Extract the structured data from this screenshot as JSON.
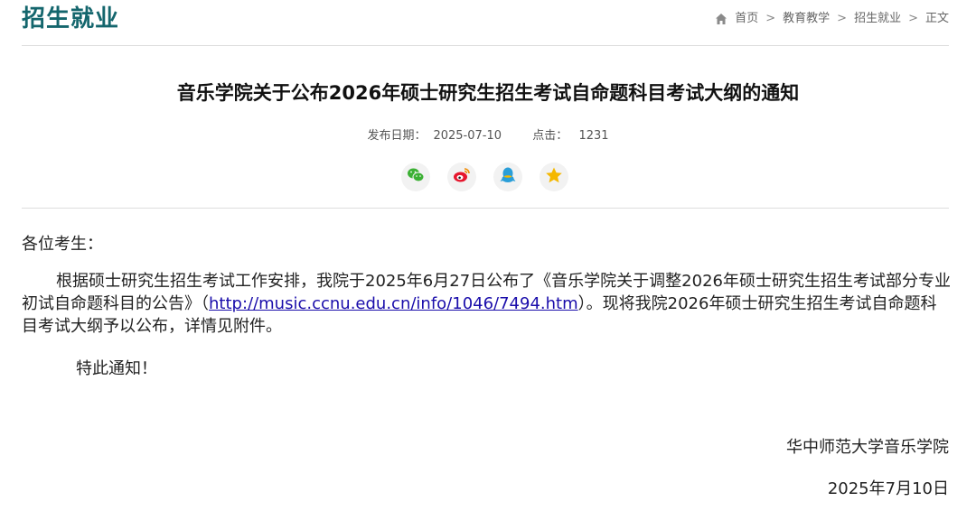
{
  "header": {
    "section_title": "招生就业",
    "breadcrumb": {
      "home": "首页",
      "items": [
        "教育教学",
        "招生就业",
        "正文"
      ],
      "separator": ">"
    }
  },
  "article": {
    "title": "音乐学院关于公布2026年硕士研究生招生考试自命题科目考试大纲的通知",
    "meta": {
      "date_label": "发布日期：",
      "date": "2025-07-10",
      "clicks_label": "点击：",
      "clicks": "1231"
    },
    "share": {
      "icons": [
        "wechat-icon",
        "weibo-icon",
        "qq-icon",
        "favorite-star-icon"
      ]
    },
    "body": {
      "greeting": "各位考生：",
      "para_before_link": "根据硕士研究生招生考试工作安排，我院于2025年6月27日公布了《音乐学院关于调整2026年硕士研究生招生考试部分专业初试自命题科目的公告》（",
      "link_text": "http://music.ccnu.edu.cn/info/1046/7494.htm",
      "para_after_link": "）。现将我院2026年硕士研究生招生考试自命题科目考试大纲予以公布，详情见附件。",
      "notice": "特此通知！"
    },
    "signature": {
      "org": "华中师范大学音乐学院",
      "date": "2025年7月10日"
    }
  },
  "colors": {
    "brand": "#14666d",
    "link": "#1a0dab",
    "wechat": "#3cb034",
    "weibo": "#e6162d",
    "qq": "#2a9ed8",
    "star": "#f5b800"
  }
}
